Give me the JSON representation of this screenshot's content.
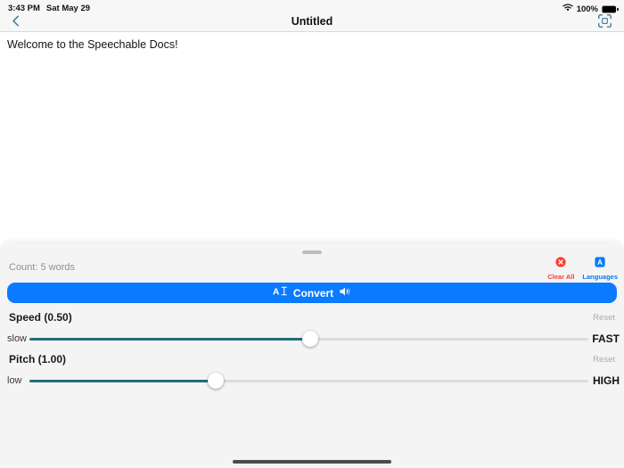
{
  "status_bar": {
    "time": "3:43 PM",
    "date": "Sat May 29",
    "battery_percent": "100%"
  },
  "nav_bar": {
    "title": "Untitled"
  },
  "editor": {
    "text": "Welcome to the Speechable Docs!"
  },
  "sheet": {
    "word_count": "Count: 5 words",
    "clear_all": {
      "label": "Clear All",
      "color": "#ff3b30"
    },
    "languages": {
      "label": "Languages",
      "color": "#007aff"
    },
    "convert": {
      "label": "Convert",
      "color": "#0a7aff"
    },
    "speed": {
      "label": "Speed (0.50)",
      "value": 0.5,
      "reset": "Reset",
      "min_label": "slow",
      "max_label": "FAST",
      "percent": 50.2
    },
    "pitch": {
      "label": "Pitch (1.00)",
      "value": 1.0,
      "reset": "Reset",
      "min_label": "low",
      "max_label": "HIGH",
      "percent": 33.3
    }
  },
  "colors": {
    "nav_icon_teal": "#4a86a0",
    "slider_teal": "#266b7c",
    "ios_blue": "#0a7aff",
    "ios_red": "#ff3b30"
  }
}
